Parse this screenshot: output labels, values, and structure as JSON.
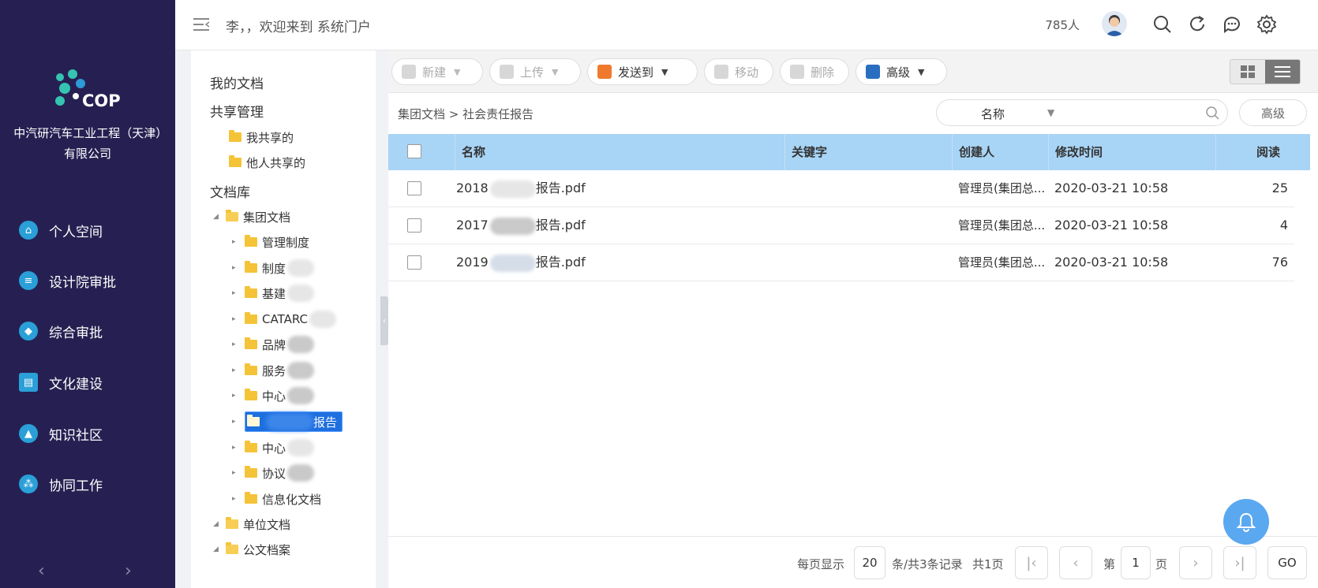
{
  "nav": {
    "logo_text": "COP",
    "company": "中汽研汽车工业工程（天津）有限公司",
    "items": [
      {
        "label": "个人空间",
        "icon": "home-icon"
      },
      {
        "label": "设计院审批",
        "icon": "list-icon"
      },
      {
        "label": "综合审批",
        "icon": "cube-icon"
      },
      {
        "label": "文化建设",
        "icon": "id-card-icon"
      },
      {
        "label": "知识社区",
        "icon": "graduation-cap-icon"
      },
      {
        "label": "协同工作",
        "icon": "share-nodes-icon"
      }
    ],
    "prev": "‹",
    "next": "›"
  },
  "header": {
    "welcome": "李，，欢迎来到 系统门户",
    "online_count": "785人"
  },
  "tree": {
    "my_docs": "我的文档",
    "share_mgmt": "共享管理",
    "my_shared": "我共享的",
    "others_shared": "他人共享的",
    "library": "文档库",
    "group_docs": "集团文档",
    "children": [
      "管理制度",
      "制度",
      "基建",
      "CATARC",
      "品牌",
      "服务",
      "中心",
      "报告",
      "中心",
      "协议",
      "信息化文档"
    ],
    "unit_docs": "单位文档",
    "official_archive": "公文档案"
  },
  "toolbar": {
    "new": "新建",
    "upload": "上传",
    "send_to": "发送到",
    "move": "移动",
    "delete": "删除",
    "advanced": "高级"
  },
  "breadcrumb": "集团文档 > 社会责任报告",
  "search": {
    "field": "名称",
    "placeholder": "",
    "advanced": "高级"
  },
  "table": {
    "columns": [
      "名称",
      "关键字",
      "创建人",
      "修改时间",
      "阅读"
    ],
    "rows": [
      {
        "name_prefix": "2018",
        "name_suffix": "报告.pdf",
        "keyword": "",
        "creator": "管理员(集团总...",
        "modified": "2020-03-21 10:58",
        "reads": "25"
      },
      {
        "name_prefix": "2017",
        "name_suffix": "报告.pdf",
        "keyword": "",
        "creator": "管理员(集团总...",
        "modified": "2020-03-21 10:58",
        "reads": "4"
      },
      {
        "name_prefix": "2019",
        "name_suffix": "报告.pdf",
        "keyword": "",
        "creator": "管理员(集团总...",
        "modified": "2020-03-21 10:58",
        "reads": "76"
      }
    ]
  },
  "pager": {
    "per_page_label": "每页显示",
    "per_page": "20",
    "total_label": "条/共3条记录",
    "pages_label": "共1页",
    "page_prefix": "第",
    "page": "1",
    "page_suffix": "页",
    "go": "GO"
  },
  "colors": {
    "nav_bg": "#262052",
    "accent": "#2a9fd8",
    "table_header": "#a8d4f5",
    "selected": "#1e6fe0"
  }
}
